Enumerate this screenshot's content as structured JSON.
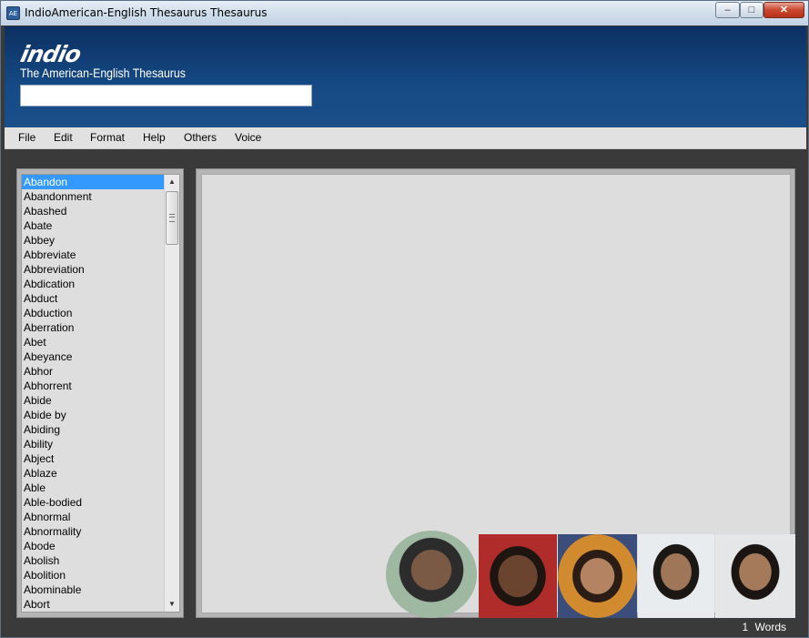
{
  "window": {
    "title": "IndioAmerican-English Thesaurus Thesaurus"
  },
  "header": {
    "logo": "indio",
    "subtitle": "The American-English Thesaurus",
    "search_value": "",
    "search_placeholder": ""
  },
  "menu": {
    "items": [
      "File",
      "Edit",
      "Format",
      "Help",
      "Others",
      "Voice"
    ]
  },
  "wordlist": {
    "selected": "Abandon",
    "items": [
      "Abandon",
      "Abandonment",
      "Abashed",
      "Abate",
      "Abbey",
      "Abbreviate",
      "Abbreviation",
      "Abdication",
      "Abduct",
      "Abduction",
      "Aberration",
      "Abet",
      "Abeyance",
      "Abhor",
      "Abhorrent",
      "Abide",
      "Abide by",
      "Abiding",
      "Ability",
      "Abject",
      "Ablaze",
      "Able",
      "Able-bodied",
      "Abnormal",
      "Abnormality",
      "Abode",
      "Abolish",
      "Abolition",
      "Abominable",
      "Abort"
    ]
  },
  "status": {
    "count": "1",
    "unit": "Words"
  },
  "theme": {
    "header_top": "#0d3061",
    "header_bottom": "#1a4f8a",
    "selection": "#3399ff",
    "window_bg": "#3a3a3a"
  }
}
